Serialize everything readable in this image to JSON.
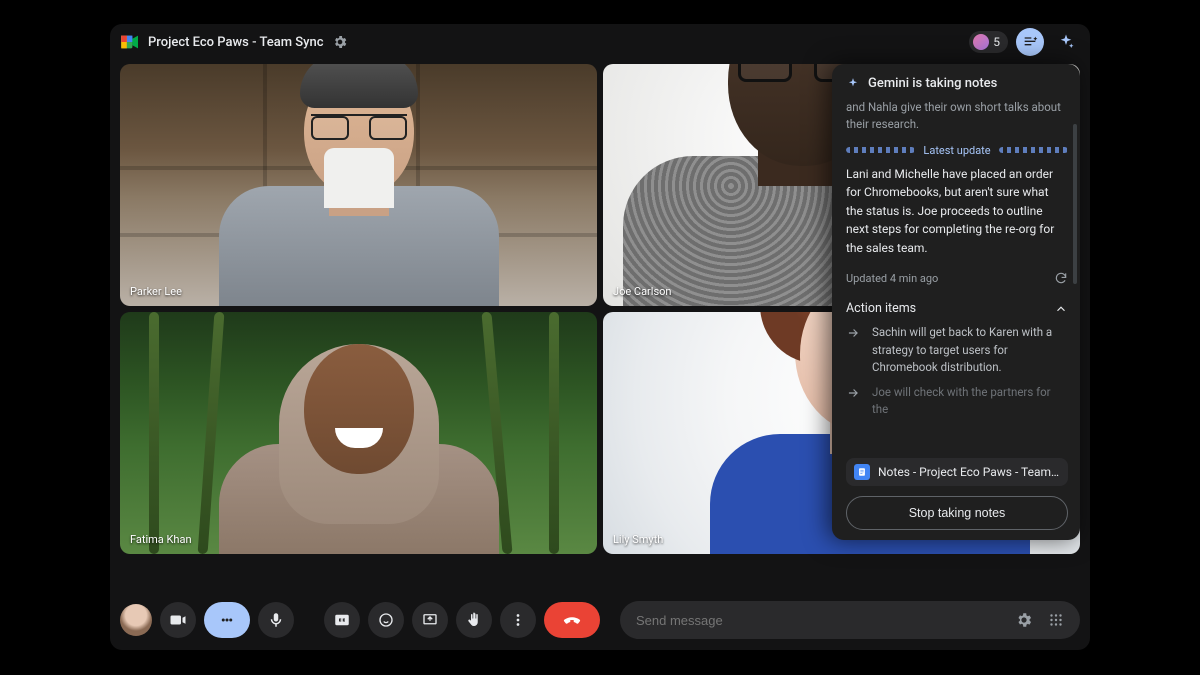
{
  "header": {
    "title": "Project Eco Paws - Team Sync",
    "participant_count": "5"
  },
  "tiles": [
    {
      "name": "Parker Lee"
    },
    {
      "name": "Joe Carlson"
    },
    {
      "name": "Fatima Khan"
    },
    {
      "name": "Lily Smyth"
    }
  ],
  "panel": {
    "heading": "Gemini is taking notes",
    "prev_snippet": "and Nahla give their own short talks about their research.",
    "divider_label": "Latest update",
    "latest": "Lani and Michelle have placed an order for Chromebooks, but aren't sure what the status is. Joe proceeds to outline next steps for completing the re-org for the sales team.",
    "updated": "Updated 4 min ago",
    "section": "Action items",
    "actions": [
      "Sachin will get back to Karen with a strategy to target users for Chromebook distribution.",
      "Joe will check with the partners for the"
    ],
    "doc_label": "Notes - Project Eco Paws - Team…",
    "stop_label": "Stop taking notes"
  },
  "chat": {
    "placeholder": "Send message"
  }
}
